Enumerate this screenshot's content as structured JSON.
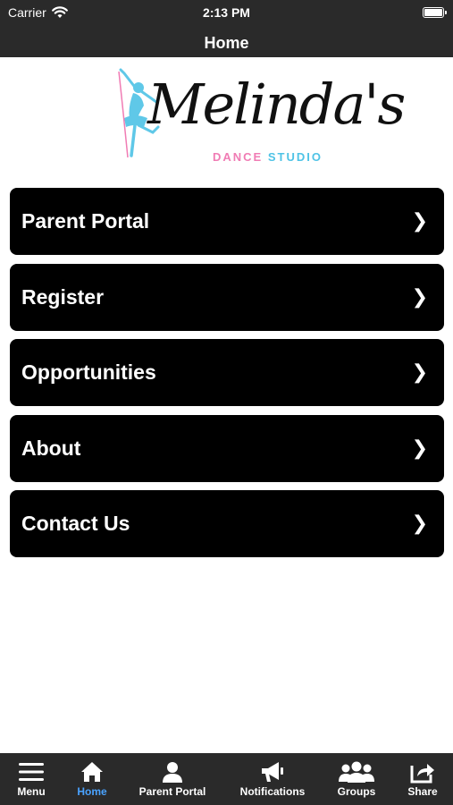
{
  "status": {
    "carrier": "Carrier",
    "time": "2:13 PM"
  },
  "nav": {
    "title": "Home"
  },
  "logo": {
    "script": "Melinda's",
    "sub_a": "DANCE",
    "sub_b": "STUDIO"
  },
  "menu": [
    {
      "label": "Parent Portal"
    },
    {
      "label": "Register"
    },
    {
      "label": "Opportunities"
    },
    {
      "label": "About"
    },
    {
      "label": "Contact Us"
    }
  ],
  "tabs": [
    {
      "label": "Menu",
      "icon": "hamburger-icon"
    },
    {
      "label": "Home",
      "icon": "home-icon",
      "active": true
    },
    {
      "label": "Parent Portal",
      "icon": "person-icon"
    },
    {
      "label": "Notifications",
      "icon": "megaphone-icon"
    },
    {
      "label": "Groups",
      "icon": "group-icon"
    },
    {
      "label": "Share",
      "icon": "share-icon"
    }
  ],
  "colors": {
    "bar": "#2a2a2a",
    "active_tab": "#4aa3ff",
    "pink": "#f07cb4",
    "blue": "#4fc3e6"
  }
}
